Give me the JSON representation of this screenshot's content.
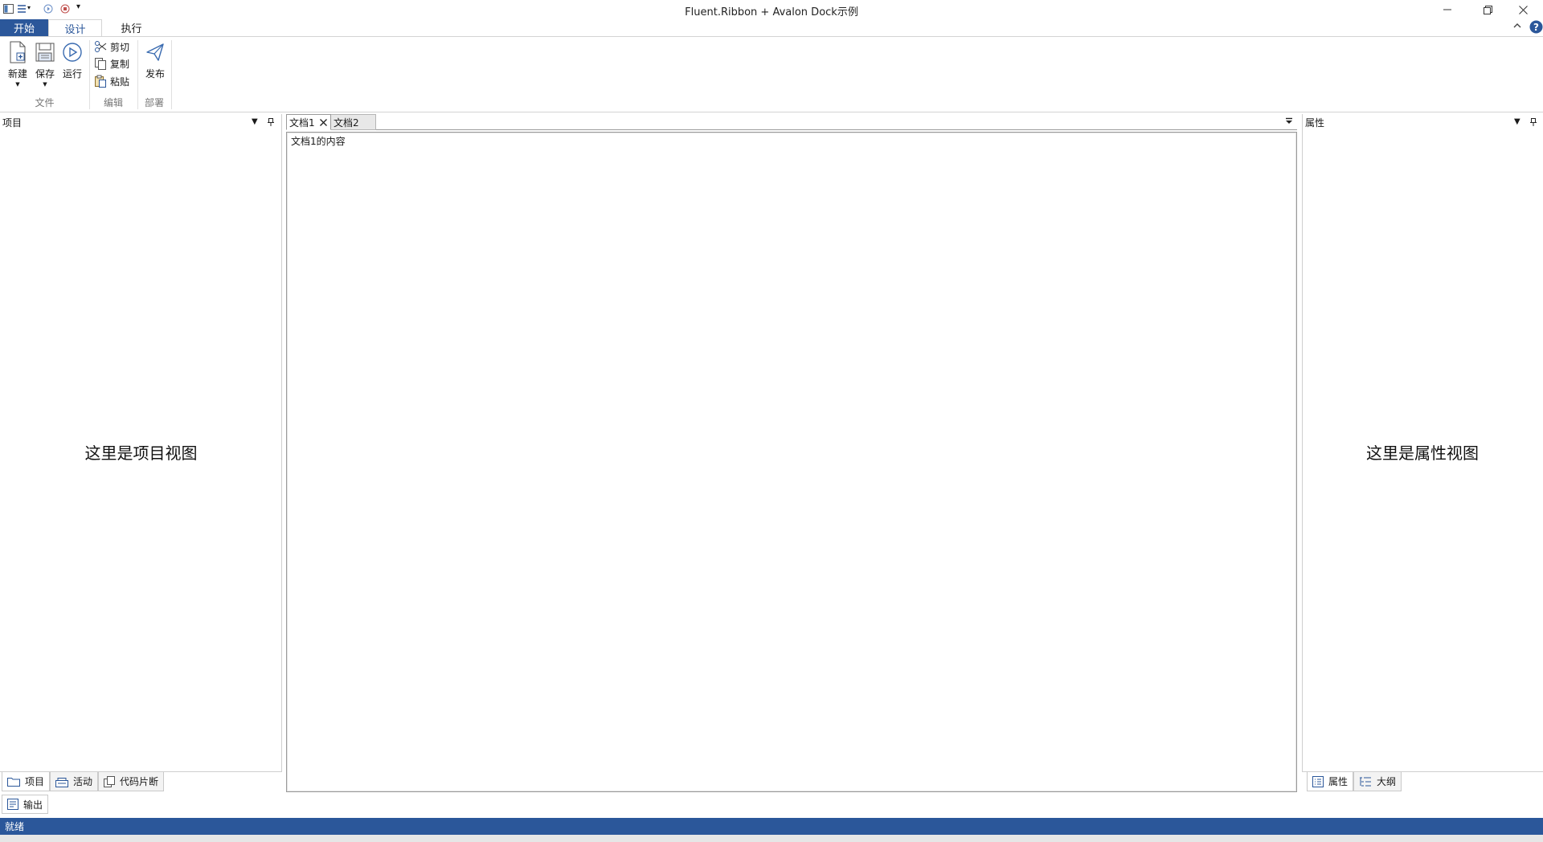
{
  "window": {
    "title": "Fluent.Ribbon + Avalon Dock示例"
  },
  "ribbon": {
    "tabs": [
      "开始",
      "设计",
      "执行"
    ],
    "buttons": {
      "new": "新建",
      "save": "保存",
      "run": "运行",
      "cut": "剪切",
      "copy": "复制",
      "paste": "粘贴",
      "publish": "发布"
    },
    "groups": [
      "文件",
      "编辑",
      "部署"
    ]
  },
  "left_pane": {
    "title": "项目",
    "body": "这里是项目视图",
    "tabs": [
      "项目",
      "活动",
      "代码片断"
    ]
  },
  "documents": {
    "tabs": [
      "文档1",
      "文档2"
    ],
    "active_content": "文档1的内容"
  },
  "right_pane": {
    "title": "属性",
    "body": "这里是属性视图",
    "tabs": [
      "属性",
      "大纲"
    ]
  },
  "bottom": {
    "output_tab": "输出"
  },
  "status": {
    "text": "就绪"
  },
  "colors": {
    "accent": "#2b579a",
    "status_bg": "#2b579a"
  }
}
